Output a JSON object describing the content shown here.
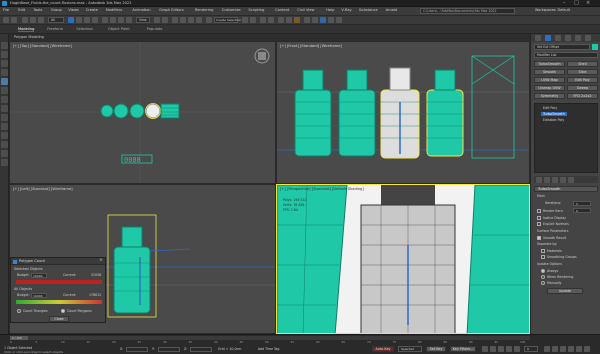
{
  "window": {
    "title": "HuginBase_Fluids.the_count.fluxions.max - Autodesk 3ds Max 2022",
    "workspace_label": "Workspaces: Default",
    "search_path": "C:\\Users\\...\\3dsMax\\Documents\\3ds Max 2022",
    "search_placeholder": "Type a keyword or phrase"
  },
  "menu": {
    "items": [
      "File",
      "Edit",
      "Tools",
      "Group",
      "Views",
      "Create",
      "Modifiers",
      "Animation",
      "Graph Editors",
      "Rendering",
      "Customize",
      "Scripting",
      "Content",
      "Civil View",
      "Help",
      "V-Ray",
      "Substance",
      "Arnold"
    ]
  },
  "toolbar": {
    "selection_filter": "All",
    "view_dropdown": "View",
    "create_selection_set": "Create Selection Se"
  },
  "ribbon": {
    "tabs": [
      "Modeling",
      "Freeform",
      "Selection",
      "Object Paint",
      "Populate"
    ],
    "active_tab": "Modeling",
    "sub_label": "Polygon Modeling"
  },
  "viewports": {
    "top_left_label": "[+] [Top] [Standard] [Wireframe]",
    "top_right_label": "[+] [Front] [Standard] [Wireframe]",
    "bottom_left_label": "[+] [Left] [Standard] [Wireframe]",
    "bottom_right_label": "[+] [Perspective] [Standard] [Default Shading]",
    "persp_stats": [
      "Polys: 156 512",
      "Verts: 78 456",
      "FPS: 1.64"
    ]
  },
  "polygon_count": {
    "title": "Polygon Count",
    "selected_objects": "Selected Objects",
    "all_objects": "All Objects",
    "budget_label": "Budget:",
    "budget_value_1": "10000",
    "current_label": "Current:",
    "current_value_1": "31008",
    "budget_value_2": "10000",
    "current_value_2": "178612",
    "count_triangles": "Count Triangles",
    "count_polygons": "Count Polygons",
    "close": "Close"
  },
  "command_panel": {
    "object_name": "Set Ext Offset",
    "modifier_list": "Modifier List",
    "modifier_buttons": [
      "TurboSmooth",
      "Shell",
      "Smooth",
      "Slice",
      "UVW Map",
      "Edit Poly",
      "Unwrap UVW",
      "Sweep",
      "Symmetry",
      "FFD 2x2x2"
    ],
    "stack": [
      "Edit Poly",
      "TurboSmooth",
      "Editable Poly"
    ],
    "rollout_title": "TurboSmooth",
    "main_label": "Main",
    "iterations_label": "Iterations:",
    "iterations_value": "2",
    "render_iters_label": "Render Iters:",
    "render_iters_value": "0",
    "isoline_display": "Isoline Display",
    "explicit_normals": "Explicit Normals",
    "surface_params": "Surface Parameters",
    "smooth_result": "Smooth Result",
    "separate_by": "Separate by:",
    "materials": "Materials",
    "smoothing_groups": "Smoothing Groups",
    "update_options": "Update Options",
    "always": "Always",
    "when_rendering": "When Rendering",
    "manually": "Manually",
    "update": "Update"
  },
  "status": {
    "timeline_pos": "0 / 100",
    "selection_status": "1 Object Selected",
    "prompt": "Click or click-and-drag to select objects",
    "x_label": "X:",
    "y_label": "Y:",
    "z_label": "Z:",
    "grid": "Grid = 10,0cm",
    "add_time_tag": "Add Time Tag",
    "auto_key": "Auto Key",
    "selected": "Selected",
    "set_key": "Set Key",
    "key_filters": "Key Filters...",
    "frame_value": "0",
    "ticks": [
      "0",
      "5",
      "10",
      "15",
      "20",
      "25",
      "30",
      "35",
      "40",
      "45",
      "50",
      "55",
      "60",
      "65",
      "70",
      "75",
      "80",
      "85",
      "90",
      "95",
      "100"
    ]
  },
  "colors": {
    "object_teal": "#1fc9a7",
    "selection_yellow": "#f5e642",
    "viewport_bg": "#4a4a4a",
    "accent_blue": "#2d6cc0"
  }
}
